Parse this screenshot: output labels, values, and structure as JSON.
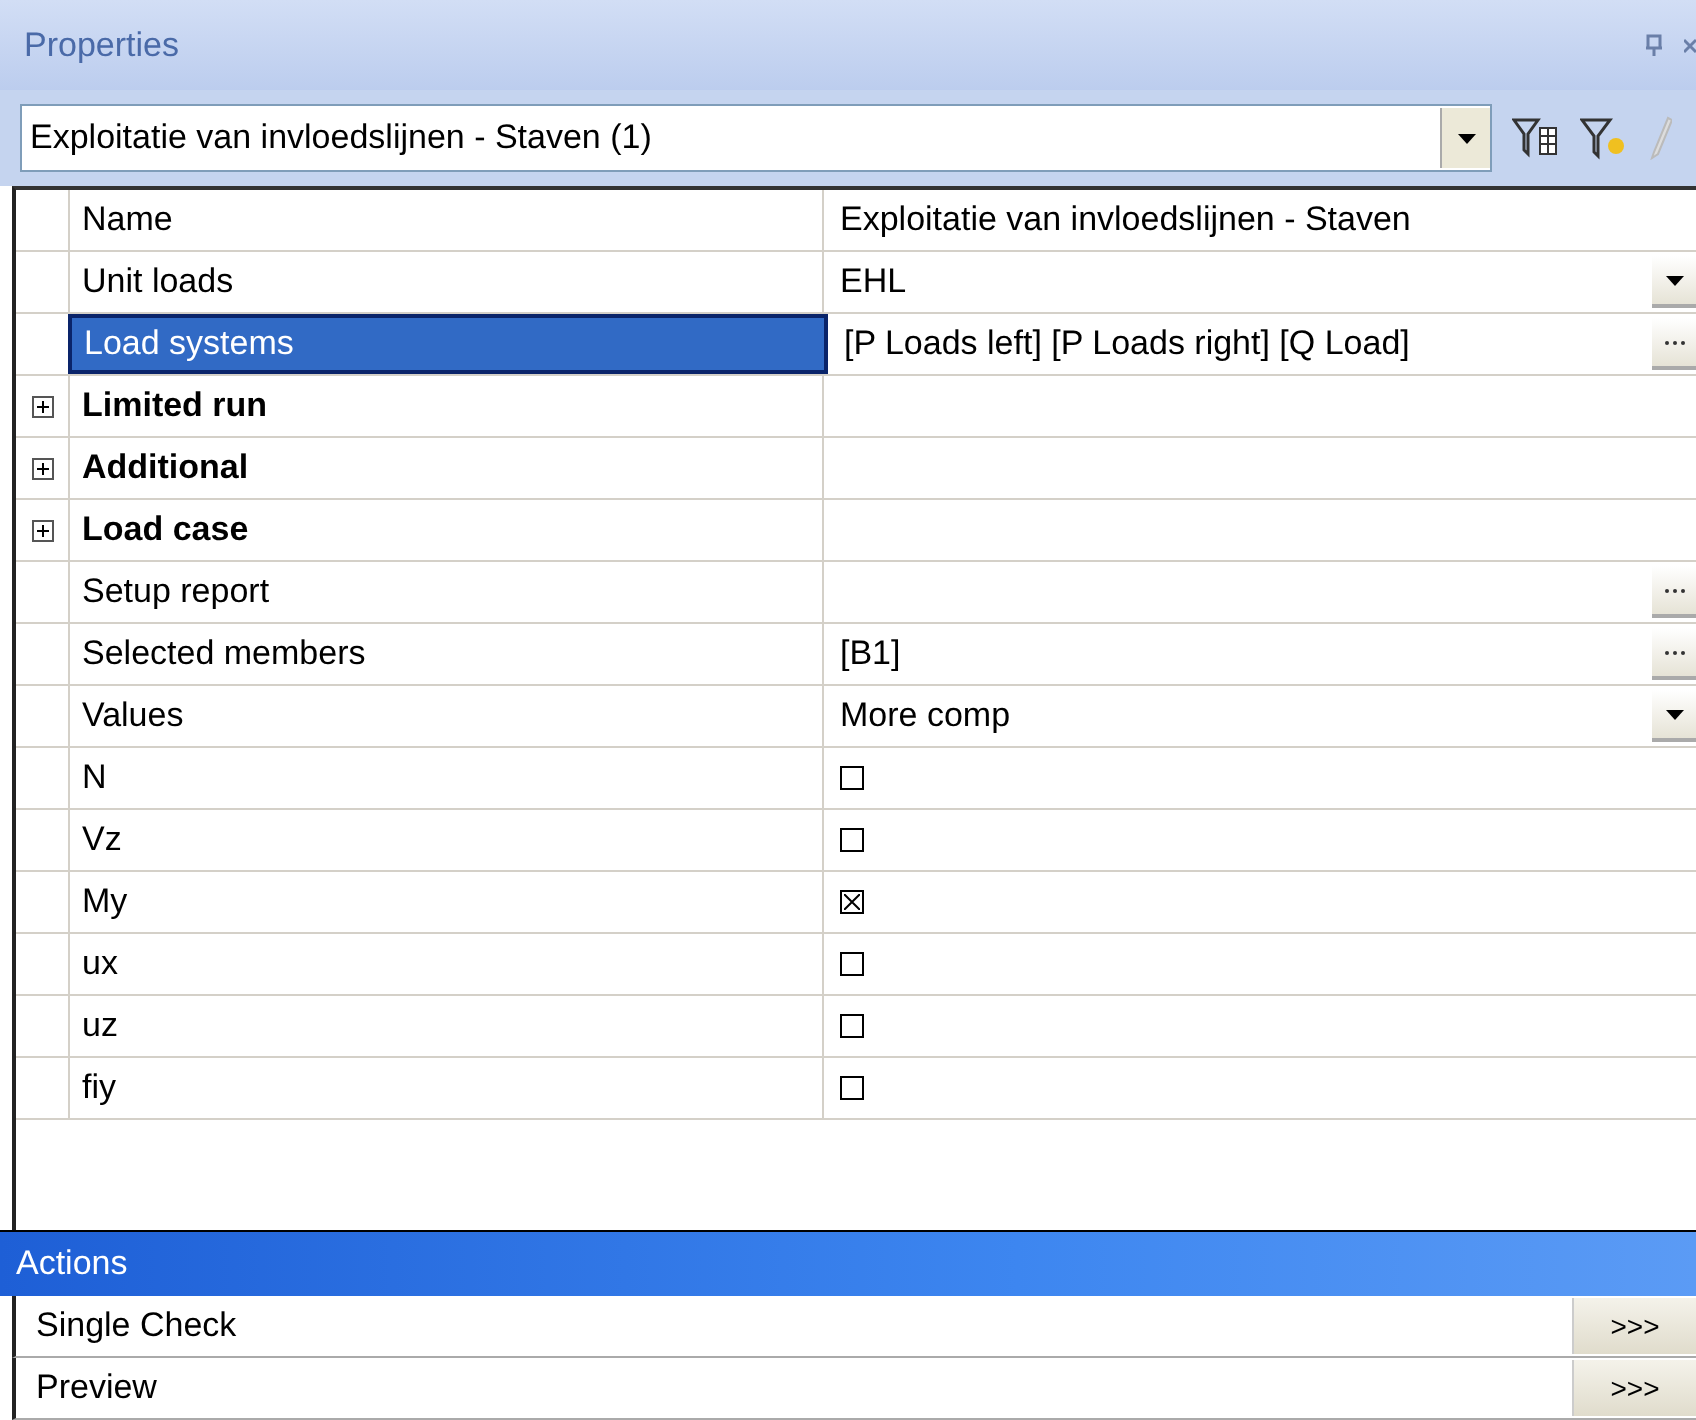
{
  "panel": {
    "title": "Properties"
  },
  "selector": {
    "value": "Exploitatie van invloedslijnen - Staven (1)"
  },
  "rows": [
    {
      "kind": "text",
      "label": "Name",
      "value": "Exploitatie van invloedslijnen - Staven",
      "selected": false
    },
    {
      "kind": "dropdown",
      "label": "Unit loads",
      "value": "EHL",
      "selected": false
    },
    {
      "kind": "ellipsis",
      "label": "Load systems",
      "value": "[P Loads left] [P Loads right] [Q Load]",
      "selected": true
    },
    {
      "kind": "category",
      "label": "Limited run",
      "expanded": false,
      "selected": false
    },
    {
      "kind": "category",
      "label": "Additional",
      "expanded": false,
      "selected": false
    },
    {
      "kind": "category",
      "label": "Load case",
      "expanded": false,
      "selected": false
    },
    {
      "kind": "ellipsis",
      "label": "Setup report",
      "value": "",
      "selected": false
    },
    {
      "kind": "ellipsis",
      "label": "Selected members",
      "value": "[B1]",
      "selected": false
    },
    {
      "kind": "dropdown",
      "label": "Values",
      "value": "More comp",
      "selected": false
    },
    {
      "kind": "checkbox",
      "label": "N",
      "checked": false,
      "selected": false
    },
    {
      "kind": "checkbox",
      "label": "Vz",
      "checked": false,
      "selected": false
    },
    {
      "kind": "checkbox",
      "label": "My",
      "checked": true,
      "selected": false
    },
    {
      "kind": "checkbox",
      "label": "ux",
      "checked": false,
      "selected": false
    },
    {
      "kind": "checkbox",
      "label": "uz",
      "checked": false,
      "selected": false
    },
    {
      "kind": "checkbox",
      "label": "fiy",
      "checked": false,
      "selected": false
    }
  ],
  "actions": {
    "title": "Actions",
    "items": [
      {
        "label": "Single Check",
        "button": ">>>"
      },
      {
        "label": "Preview",
        "button": ">>>"
      }
    ]
  }
}
